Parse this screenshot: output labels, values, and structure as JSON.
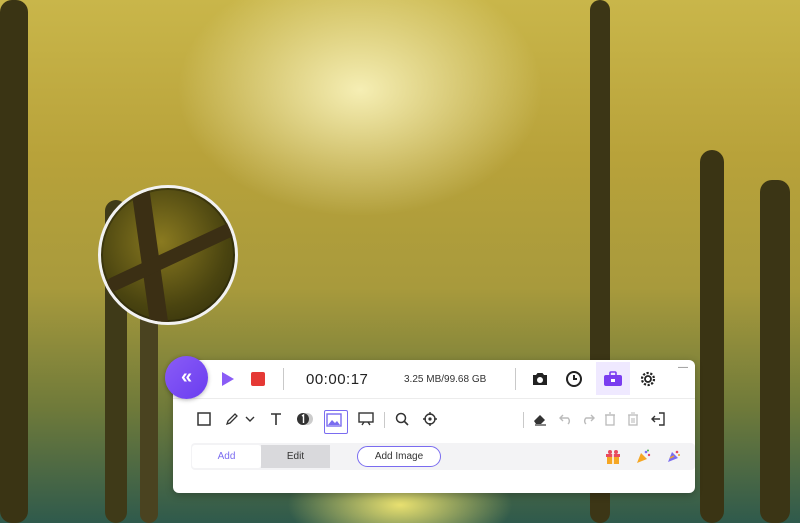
{
  "recorder": {
    "timer": "00:00:17",
    "storage": "3.25 MB/99.68 GB",
    "tabs": [
      {
        "label": "Add"
      },
      {
        "label": "Edit"
      }
    ],
    "add_image_label": "Add Image",
    "minimize_glyph": "—",
    "collapse_glyph": "«"
  },
  "colors": {
    "accent": "#7a6cf0",
    "record_stop": "#e53935",
    "play": "#8a5cf6"
  },
  "icons": {
    "collapse": "double-chevron-left-icon",
    "play": "play-icon",
    "stop": "stop-icon",
    "camera": "camera-icon",
    "schedule": "clock-icon",
    "toolbox": "toolbox-icon",
    "settings": "gear-icon"
  }
}
